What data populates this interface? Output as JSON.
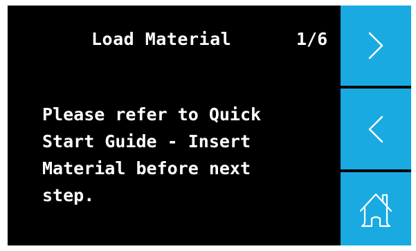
{
  "header": {
    "title": "Load Material",
    "page_indicator": "1/6"
  },
  "message": {
    "lines": [
      "Please refer to Quick",
      "Start Guide - Insert",
      "Material before next",
      "step."
    ]
  },
  "side_buttons": {
    "next_icon": "chevron-right-icon",
    "back_icon": "chevron-left-icon",
    "home_icon": "home-icon",
    "accent_color": "#1aaae2"
  }
}
